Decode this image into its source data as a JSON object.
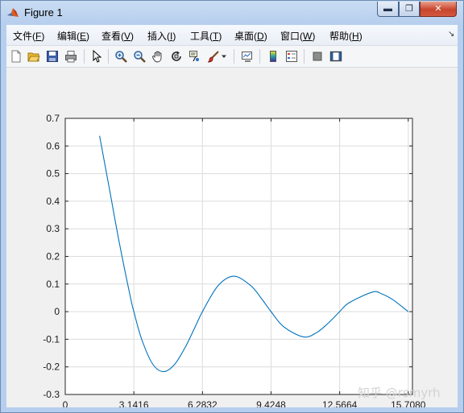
{
  "window": {
    "title": "Figure 1",
    "controls": {
      "minimize": "▬",
      "maximize": "❐",
      "close": "✕"
    }
  },
  "menu": [
    {
      "label": "文件",
      "key": "F"
    },
    {
      "label": "编辑",
      "key": "E"
    },
    {
      "label": "查看",
      "key": "V"
    },
    {
      "label": "插入",
      "key": "I"
    },
    {
      "label": "工具",
      "key": "T"
    },
    {
      "label": "桌面",
      "key": "D"
    },
    {
      "label": "窗口",
      "key": "W"
    },
    {
      "label": "帮助",
      "key": "H"
    }
  ],
  "toolbar_icons": [
    "new-figure-icon",
    "open-file-icon",
    "save-icon",
    "print-icon",
    "pointer-icon",
    "zoom-in-icon",
    "zoom-out-icon",
    "pan-hand-icon",
    "rotate-3d-icon",
    "data-cursor-icon",
    "brush-icon",
    "brush-dropdown-icon",
    "link-plot-icon",
    "colorbar-icon",
    "legend-icon",
    "hide-plot-tools-icon",
    "show-plot-tools-icon"
  ],
  "colors": {
    "line": "#0072bd",
    "grid": "#dcdcdc",
    "axes": "#262626",
    "figure_bg": "#f0f0f0",
    "axes_bg": "#ffffff"
  },
  "chart_data": {
    "type": "line",
    "title": "",
    "xlabel": "",
    "ylabel": "",
    "xlim": [
      0,
      15.9
    ],
    "ylim": [
      -0.3,
      0.7
    ],
    "xticks": [
      0,
      3.1416,
      6.2832,
      9.4248,
      12.5664,
      15.708
    ],
    "xtick_labels": [
      "0",
      "3.1416",
      "6.2832",
      "9.4248",
      "12.5664",
      "15.7080"
    ],
    "yticks": [
      -0.3,
      -0.2,
      -0.1,
      0,
      0.1,
      0.2,
      0.3,
      0.4,
      0.5,
      0.6,
      0.7
    ],
    "ytick_labels": [
      "-0.3",
      "-0.2",
      "-0.1",
      "0",
      "0.1",
      "0.2",
      "0.3",
      "0.4",
      "0.5",
      "0.6",
      "0.7"
    ],
    "grid": true,
    "series": [
      {
        "x": [
          1.5708,
          2.0,
          2.5,
          3.0,
          3.1416,
          3.5,
          4.0,
          4.4934,
          5.0,
          5.5,
          6.0,
          6.2832,
          7.0,
          7.7253,
          8.5,
          9.0,
          9.4248,
          10.0,
          10.9041,
          11.5,
          12.0,
          12.5664,
          13.0,
          14.0662,
          14.5,
          15.0,
          15.708
        ],
        "y": [
          0.6366,
          0.4546,
          0.2394,
          0.047,
          0.0,
          -0.1002,
          -0.1892,
          -0.2172,
          -0.1918,
          -0.1282,
          -0.0466,
          0.0,
          0.0939,
          0.1284,
          0.0939,
          0.0458,
          0.0,
          -0.0544,
          -0.0913,
          -0.0764,
          -0.0447,
          0.0,
          0.0323,
          0.0709,
          0.0641,
          0.0433,
          0.0
        ]
      }
    ]
  },
  "watermark": "知乎 @rsmyrh"
}
